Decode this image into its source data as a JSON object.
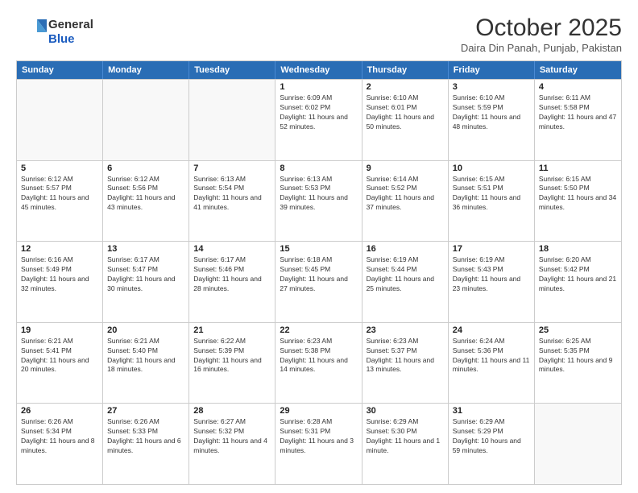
{
  "logo": {
    "general": "General",
    "blue": "Blue"
  },
  "header": {
    "month": "October 2025",
    "location": "Daira Din Panah, Punjab, Pakistan"
  },
  "days": [
    "Sunday",
    "Monday",
    "Tuesday",
    "Wednesday",
    "Thursday",
    "Friday",
    "Saturday"
  ],
  "rows": [
    [
      {
        "day": "",
        "empty": true
      },
      {
        "day": "",
        "empty": true
      },
      {
        "day": "",
        "empty": true
      },
      {
        "day": "1",
        "sunrise": "Sunrise: 6:09 AM",
        "sunset": "Sunset: 6:02 PM",
        "daylight": "Daylight: 11 hours and 52 minutes."
      },
      {
        "day": "2",
        "sunrise": "Sunrise: 6:10 AM",
        "sunset": "Sunset: 6:01 PM",
        "daylight": "Daylight: 11 hours and 50 minutes."
      },
      {
        "day": "3",
        "sunrise": "Sunrise: 6:10 AM",
        "sunset": "Sunset: 5:59 PM",
        "daylight": "Daylight: 11 hours and 48 minutes."
      },
      {
        "day": "4",
        "sunrise": "Sunrise: 6:11 AM",
        "sunset": "Sunset: 5:58 PM",
        "daylight": "Daylight: 11 hours and 47 minutes."
      }
    ],
    [
      {
        "day": "5",
        "sunrise": "Sunrise: 6:12 AM",
        "sunset": "Sunset: 5:57 PM",
        "daylight": "Daylight: 11 hours and 45 minutes."
      },
      {
        "day": "6",
        "sunrise": "Sunrise: 6:12 AM",
        "sunset": "Sunset: 5:56 PM",
        "daylight": "Daylight: 11 hours and 43 minutes."
      },
      {
        "day": "7",
        "sunrise": "Sunrise: 6:13 AM",
        "sunset": "Sunset: 5:54 PM",
        "daylight": "Daylight: 11 hours and 41 minutes."
      },
      {
        "day": "8",
        "sunrise": "Sunrise: 6:13 AM",
        "sunset": "Sunset: 5:53 PM",
        "daylight": "Daylight: 11 hours and 39 minutes."
      },
      {
        "day": "9",
        "sunrise": "Sunrise: 6:14 AM",
        "sunset": "Sunset: 5:52 PM",
        "daylight": "Daylight: 11 hours and 37 minutes."
      },
      {
        "day": "10",
        "sunrise": "Sunrise: 6:15 AM",
        "sunset": "Sunset: 5:51 PM",
        "daylight": "Daylight: 11 hours and 36 minutes."
      },
      {
        "day": "11",
        "sunrise": "Sunrise: 6:15 AM",
        "sunset": "Sunset: 5:50 PM",
        "daylight": "Daylight: 11 hours and 34 minutes."
      }
    ],
    [
      {
        "day": "12",
        "sunrise": "Sunrise: 6:16 AM",
        "sunset": "Sunset: 5:49 PM",
        "daylight": "Daylight: 11 hours and 32 minutes."
      },
      {
        "day": "13",
        "sunrise": "Sunrise: 6:17 AM",
        "sunset": "Sunset: 5:47 PM",
        "daylight": "Daylight: 11 hours and 30 minutes."
      },
      {
        "day": "14",
        "sunrise": "Sunrise: 6:17 AM",
        "sunset": "Sunset: 5:46 PM",
        "daylight": "Daylight: 11 hours and 28 minutes."
      },
      {
        "day": "15",
        "sunrise": "Sunrise: 6:18 AM",
        "sunset": "Sunset: 5:45 PM",
        "daylight": "Daylight: 11 hours and 27 minutes."
      },
      {
        "day": "16",
        "sunrise": "Sunrise: 6:19 AM",
        "sunset": "Sunset: 5:44 PM",
        "daylight": "Daylight: 11 hours and 25 minutes."
      },
      {
        "day": "17",
        "sunrise": "Sunrise: 6:19 AM",
        "sunset": "Sunset: 5:43 PM",
        "daylight": "Daylight: 11 hours and 23 minutes."
      },
      {
        "day": "18",
        "sunrise": "Sunrise: 6:20 AM",
        "sunset": "Sunset: 5:42 PM",
        "daylight": "Daylight: 11 hours and 21 minutes."
      }
    ],
    [
      {
        "day": "19",
        "sunrise": "Sunrise: 6:21 AM",
        "sunset": "Sunset: 5:41 PM",
        "daylight": "Daylight: 11 hours and 20 minutes."
      },
      {
        "day": "20",
        "sunrise": "Sunrise: 6:21 AM",
        "sunset": "Sunset: 5:40 PM",
        "daylight": "Daylight: 11 hours and 18 minutes."
      },
      {
        "day": "21",
        "sunrise": "Sunrise: 6:22 AM",
        "sunset": "Sunset: 5:39 PM",
        "daylight": "Daylight: 11 hours and 16 minutes."
      },
      {
        "day": "22",
        "sunrise": "Sunrise: 6:23 AM",
        "sunset": "Sunset: 5:38 PM",
        "daylight": "Daylight: 11 hours and 14 minutes."
      },
      {
        "day": "23",
        "sunrise": "Sunrise: 6:23 AM",
        "sunset": "Sunset: 5:37 PM",
        "daylight": "Daylight: 11 hours and 13 minutes."
      },
      {
        "day": "24",
        "sunrise": "Sunrise: 6:24 AM",
        "sunset": "Sunset: 5:36 PM",
        "daylight": "Daylight: 11 hours and 11 minutes."
      },
      {
        "day": "25",
        "sunrise": "Sunrise: 6:25 AM",
        "sunset": "Sunset: 5:35 PM",
        "daylight": "Daylight: 11 hours and 9 minutes."
      }
    ],
    [
      {
        "day": "26",
        "sunrise": "Sunrise: 6:26 AM",
        "sunset": "Sunset: 5:34 PM",
        "daylight": "Daylight: 11 hours and 8 minutes."
      },
      {
        "day": "27",
        "sunrise": "Sunrise: 6:26 AM",
        "sunset": "Sunset: 5:33 PM",
        "daylight": "Daylight: 11 hours and 6 minutes."
      },
      {
        "day": "28",
        "sunrise": "Sunrise: 6:27 AM",
        "sunset": "Sunset: 5:32 PM",
        "daylight": "Daylight: 11 hours and 4 minutes."
      },
      {
        "day": "29",
        "sunrise": "Sunrise: 6:28 AM",
        "sunset": "Sunset: 5:31 PM",
        "daylight": "Daylight: 11 hours and 3 minutes."
      },
      {
        "day": "30",
        "sunrise": "Sunrise: 6:29 AM",
        "sunset": "Sunset: 5:30 PM",
        "daylight": "Daylight: 11 hours and 1 minute."
      },
      {
        "day": "31",
        "sunrise": "Sunrise: 6:29 AM",
        "sunset": "Sunset: 5:29 PM",
        "daylight": "Daylight: 10 hours and 59 minutes."
      },
      {
        "day": "",
        "empty": true
      }
    ]
  ]
}
